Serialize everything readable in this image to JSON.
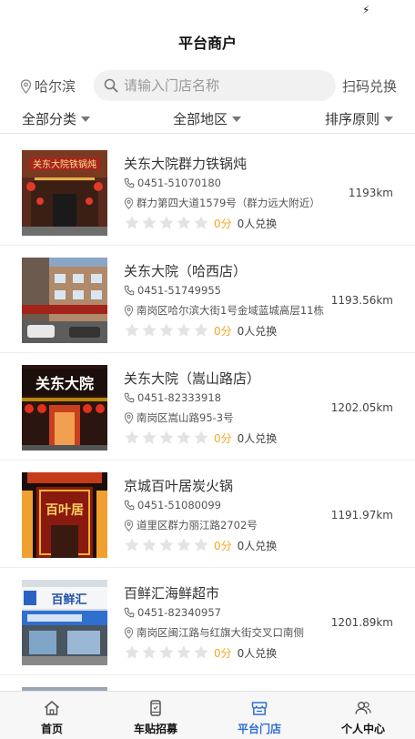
{
  "colors": {
    "accent": "#2d6fd1",
    "star": "#e3e3e3",
    "score": "#f5a623"
  },
  "status_bar": {
    "icon": "lightning-icon"
  },
  "header": {
    "title": "平台商户"
  },
  "search": {
    "city": "哈尔滨",
    "placeholder": "请输入门店名称",
    "value": "",
    "scan_label": "扫码兑换"
  },
  "filters": [
    {
      "label": "全部分类"
    },
    {
      "label": "全部地区"
    },
    {
      "label": "排序原则"
    }
  ],
  "stores": [
    {
      "name": "关东大院群力铁锅炖",
      "phone": "0451-51070180",
      "address": "群力第四大道1579号（群力远大附近）",
      "score": "0分",
      "redeem": "0人兑换",
      "rating": 0,
      "distance": "1193km",
      "sign_text": "关东大院铁锅炖"
    },
    {
      "name": "关东大院（哈西店）",
      "phone": "0451-51749955",
      "address": "南岗区哈尔滨大街1号金域蓝城高层11栋",
      "score": "0分",
      "redeem": "0人兑换",
      "rating": 0,
      "distance": "1193.56km",
      "sign_text": ""
    },
    {
      "name": "关东大院（嵩山路店）",
      "phone": "0451-82333918",
      "address": "南岗区嵩山路95-3号",
      "score": "0分",
      "redeem": "0人兑换",
      "rating": 0,
      "distance": "1202.05km",
      "sign_text": "关东大院"
    },
    {
      "name": "京城百叶居炭火锅",
      "phone": "0451-51080099",
      "address": "道里区群力丽江路2702号",
      "score": "0分",
      "redeem": "0人兑换",
      "rating": 0,
      "distance": "1191.97km",
      "sign_text": "百叶居"
    },
    {
      "name": "百鲜汇海鲜超市",
      "phone": "0451-82340957",
      "address": "南岗区闽江路与红旗大街交叉口南侧",
      "score": "0分",
      "redeem": "0人兑换",
      "rating": 0,
      "distance": "1201.89km",
      "sign_text": "百鲜汇"
    }
  ],
  "tabs": [
    {
      "label": "首页",
      "icon": "home-icon",
      "active": false
    },
    {
      "label": "车贴招募",
      "icon": "phone-icon",
      "active": false
    },
    {
      "label": "平台门店",
      "icon": "store-icon",
      "active": true
    },
    {
      "label": "个人中心",
      "icon": "user-icon",
      "active": false
    }
  ]
}
